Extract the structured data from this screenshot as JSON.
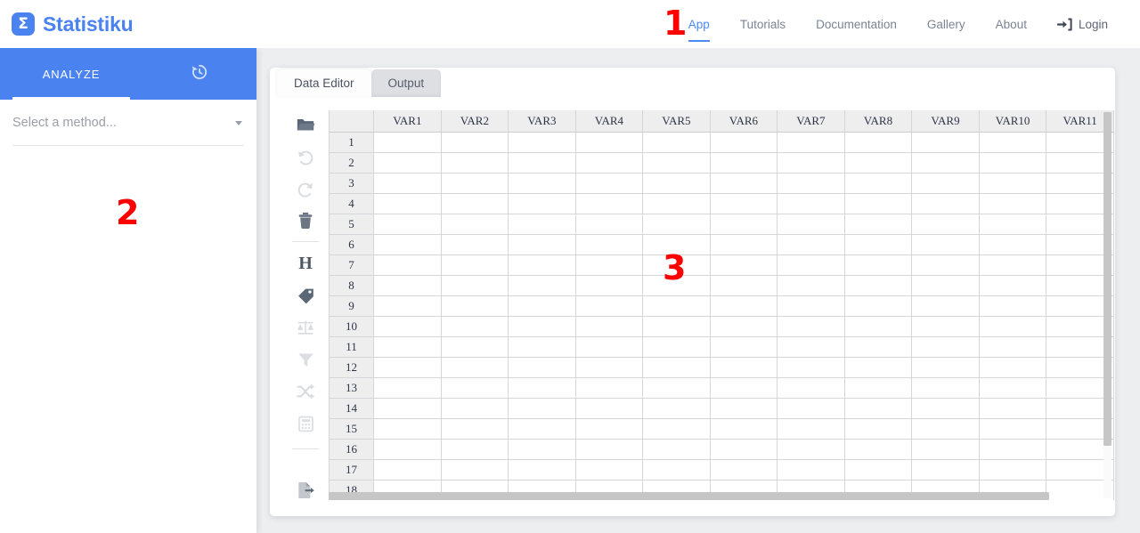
{
  "topbar": {
    "brand": {
      "mark": "sigma-icon",
      "mark_glyph": "Σ",
      "name": "Statistiku"
    },
    "nav": [
      {
        "label": "App",
        "active": true
      },
      {
        "label": "Tutorials",
        "active": false
      },
      {
        "label": "Documentation",
        "active": false
      },
      {
        "label": "Gallery",
        "active": false
      },
      {
        "label": "About",
        "active": false
      }
    ],
    "login": {
      "label": "Login",
      "icon": "sign-in-icon"
    }
  },
  "annotations": [
    {
      "id": "1",
      "label": "1"
    },
    {
      "id": "2",
      "label": "2"
    },
    {
      "id": "3",
      "label": "3"
    }
  ],
  "sidebar": {
    "tabs": [
      {
        "label": "ANALYZE",
        "active": true
      },
      {
        "label": "",
        "icon": "history-icon",
        "active": false
      }
    ],
    "method_select": {
      "placeholder": "Select a method...",
      "value": "Select a method...",
      "caret": "chevron-down-icon"
    }
  },
  "card": {
    "tabs": [
      {
        "label": "Data Editor",
        "active": true
      },
      {
        "label": "Output",
        "active": false
      }
    ],
    "toolbar": [
      {
        "name": "open-file-icon",
        "enabled": true
      },
      {
        "name": "undo-icon",
        "enabled": false
      },
      {
        "name": "redo-icon",
        "enabled": false
      },
      {
        "name": "delete-icon",
        "enabled": true
      },
      {
        "name": "divider",
        "enabled": false
      },
      {
        "name": "header-icon",
        "enabled": true,
        "glyph": "H"
      },
      {
        "name": "label-tag-icon",
        "enabled": true
      },
      {
        "name": "weights-balance-icon",
        "enabled": false
      },
      {
        "name": "filter-icon",
        "enabled": false
      },
      {
        "name": "shuffle-icon",
        "enabled": false
      },
      {
        "name": "compute-calculator-icon",
        "enabled": false
      },
      {
        "name": "divider",
        "enabled": false
      },
      {
        "name": "export-file-icon",
        "enabled": true
      }
    ],
    "sheet": {
      "columns": [
        "VAR1",
        "VAR2",
        "VAR3",
        "VAR4",
        "VAR5",
        "VAR6",
        "VAR7",
        "VAR8",
        "VAR9",
        "VAR10",
        "VAR11"
      ],
      "rows": [
        "1",
        "2",
        "3",
        "4",
        "5",
        "6",
        "7",
        "8",
        "9",
        "10",
        "11",
        "12",
        "13",
        "14",
        "15",
        "16",
        "17",
        "18"
      ],
      "cells": []
    }
  },
  "colors": {
    "brand_blue": "#4a83f0",
    "nav_active": "#4a8af5",
    "annotation_red": "#fc0000",
    "page_bg": "#eceef0",
    "header_gray": "#eeeeee",
    "grid_line": "#d4d6d9"
  }
}
